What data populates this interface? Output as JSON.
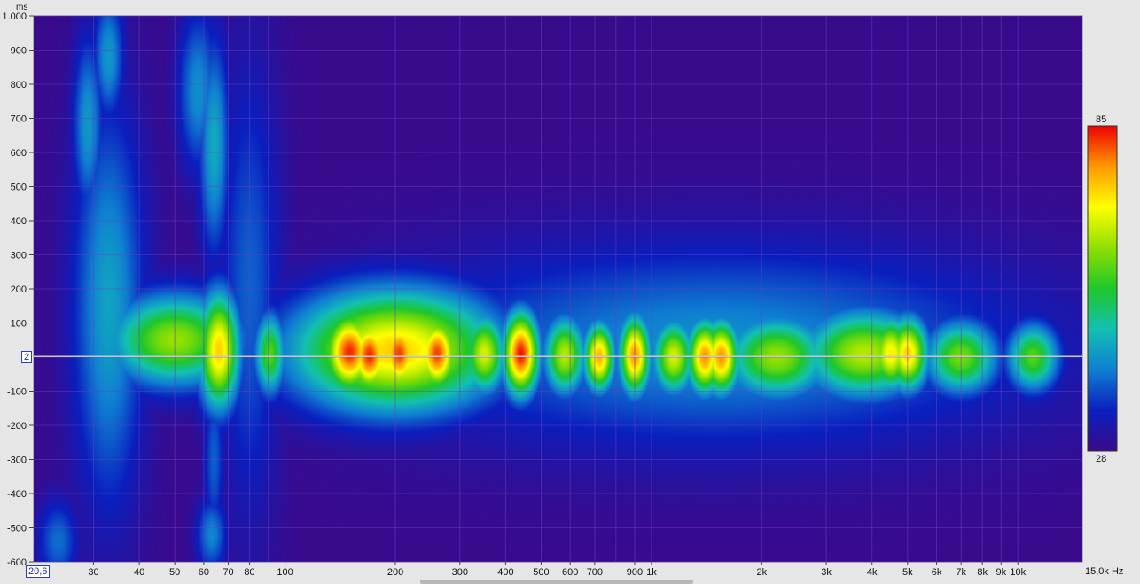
{
  "chart_data": {
    "type": "heatmap",
    "title": "",
    "x_axis": {
      "unit": "Hz",
      "scale": "log",
      "range": [
        20.6,
        15000
      ],
      "ticks": [
        {
          "value": 30,
          "label": "30"
        },
        {
          "value": 40,
          "label": "40"
        },
        {
          "value": 50,
          "label": "50"
        },
        {
          "value": 60,
          "label": "60"
        },
        {
          "value": 70,
          "label": "70"
        },
        {
          "value": 80,
          "label": "80"
        },
        {
          "value": 100,
          "label": "100"
        },
        {
          "value": 200,
          "label": "200"
        },
        {
          "value": 300,
          "label": "300"
        },
        {
          "value": 400,
          "label": "400"
        },
        {
          "value": 500,
          "label": "500"
        },
        {
          "value": 600,
          "label": "600"
        },
        {
          "value": 700,
          "label": "700"
        },
        {
          "value": 900,
          "label": "900"
        },
        {
          "value": 1000,
          "label": "1k"
        },
        {
          "value": 2000,
          "label": "2k"
        },
        {
          "value": 3000,
          "label": "3k"
        },
        {
          "value": 4000,
          "label": "4k"
        },
        {
          "value": 5000,
          "label": "5k"
        },
        {
          "value": 6000,
          "label": "6k"
        },
        {
          "value": 7000,
          "label": "7k"
        },
        {
          "value": 8000,
          "label": "8k"
        },
        {
          "value": 9000,
          "label": "9k"
        },
        {
          "value": 10000,
          "label": "10k"
        }
      ],
      "cursor_label": "20,6",
      "end_label": "15,0k"
    },
    "y_axis": {
      "unit": "ms",
      "range": [
        -600,
        1000
      ],
      "ticks": [
        {
          "value": 1000,
          "label": "1.000"
        },
        {
          "value": 900,
          "label": "900"
        },
        {
          "value": 800,
          "label": "800"
        },
        {
          "value": 700,
          "label": "700"
        },
        {
          "value": 600,
          "label": "600"
        },
        {
          "value": 500,
          "label": "500"
        },
        {
          "value": 400,
          "label": "400"
        },
        {
          "value": 300,
          "label": "300"
        },
        {
          "value": 200,
          "label": "200"
        },
        {
          "value": 100,
          "label": "100"
        },
        {
          "value": -100,
          "label": "-100"
        },
        {
          "value": -200,
          "label": "-200"
        },
        {
          "value": -300,
          "label": "-300"
        },
        {
          "value": -400,
          "label": "-400"
        },
        {
          "value": -500,
          "label": "-500"
        },
        {
          "value": -600,
          "label": "-600"
        }
      ],
      "cursor_value": 2,
      "cursor_label": "2"
    },
    "color_scale": {
      "min": 28,
      "max": 85,
      "min_label": "28",
      "max_label": "85",
      "colors": [
        "#3a0a8c",
        "#0a1fbf",
        "#0f7fd2",
        "#12c0b2",
        "#1ec72a",
        "#8fe000",
        "#ffff00",
        "#ff9900",
        "#ee0000"
      ]
    },
    "grid": true,
    "background_color": "#3f108e",
    "cursor_line_color": "#c8c8c8",
    "blobs": [
      {
        "f": 80,
        "t": 200,
        "f_spread": 0.06,
        "t_spread": 480,
        "level": 40
      },
      {
        "f": 33,
        "t": 150,
        "f_spread": 0.07,
        "t_spread": 420,
        "level": 46
      },
      {
        "f": 29,
        "t": 680,
        "f_spread": 0.03,
        "t_spread": 190,
        "level": 45
      },
      {
        "f": 33,
        "t": 880,
        "f_spread": 0.03,
        "t_spread": 130,
        "level": 45
      },
      {
        "f": 58,
        "t": 780,
        "f_spread": 0.04,
        "t_spread": 170,
        "level": 44
      },
      {
        "f": 64,
        "t": 620,
        "f_spread": 0.03,
        "t_spread": 230,
        "level": 47
      },
      {
        "f": 50,
        "t": 50,
        "f_spread": 0.13,
        "t_spread": 95,
        "level": 64
      },
      {
        "f": 66,
        "t": 20,
        "f_spread": 0.04,
        "t_spread": 120,
        "level": 74
      },
      {
        "f": 91,
        "t": 10,
        "f_spread": 0.03,
        "t_spread": 85,
        "level": 60
      },
      {
        "f": 63,
        "t": -520,
        "f_spread": 0.03,
        "t_spread": 80,
        "level": 43
      },
      {
        "f": 24,
        "t": -540,
        "f_spread": 0.04,
        "t_spread": 90,
        "level": 41
      },
      {
        "f": 64,
        "t": -300,
        "f_spread": 0.02,
        "t_spread": 170,
        "level": 40
      },
      {
        "f": 200,
        "t": 20,
        "f_spread": 0.2,
        "t_spread": 125,
        "level": 74
      },
      {
        "f": 150,
        "t": 15,
        "f_spread": 0.05,
        "t_spread": 85,
        "level": 83
      },
      {
        "f": 170,
        "t": 5,
        "f_spread": 0.04,
        "t_spread": 80,
        "level": 83
      },
      {
        "f": 205,
        "t": 10,
        "f_spread": 0.04,
        "t_spread": 80,
        "level": 82
      },
      {
        "f": 260,
        "t": 10,
        "f_spread": 0.04,
        "t_spread": 80,
        "level": 82
      },
      {
        "f": 350,
        "t": 10,
        "f_spread": 0.04,
        "t_spread": 80,
        "level": 68
      },
      {
        "f": 440,
        "t": 10,
        "f_spread": 0.035,
        "t_spread": 85,
        "level": 84
      },
      {
        "f": 580,
        "t": 5,
        "f_spread": 0.04,
        "t_spread": 80,
        "level": 66
      },
      {
        "f": 720,
        "t": 0,
        "f_spread": 0.03,
        "t_spread": 70,
        "level": 76
      },
      {
        "f": 900,
        "t": 5,
        "f_spread": 0.03,
        "t_spread": 80,
        "level": 78
      },
      {
        "f": 1150,
        "t": 0,
        "f_spread": 0.04,
        "t_spread": 75,
        "level": 68
      },
      {
        "f": 1400,
        "t": 0,
        "f_spread": 0.035,
        "t_spread": 75,
        "level": 78
      },
      {
        "f": 1550,
        "t": 0,
        "f_spread": 0.035,
        "t_spread": 75,
        "level": 78
      },
      {
        "f": 2200,
        "t": 0,
        "f_spread": 0.1,
        "t_spread": 85,
        "level": 64
      },
      {
        "f": 3800,
        "t": 10,
        "f_spread": 0.12,
        "t_spread": 90,
        "level": 66
      },
      {
        "f": 4500,
        "t": 10,
        "f_spread": 0.04,
        "t_spread": 75,
        "level": 72
      },
      {
        "f": 5000,
        "t": 10,
        "f_spread": 0.04,
        "t_spread": 75,
        "level": 74
      },
      {
        "f": 7000,
        "t": 0,
        "f_spread": 0.07,
        "t_spread": 75,
        "level": 62
      },
      {
        "f": 11000,
        "t": 0,
        "f_spread": 0.05,
        "t_spread": 70,
        "level": 60
      },
      {
        "f": 1500,
        "t": 30,
        "f_spread": 0.62,
        "t_spread": 210,
        "level": 44
      }
    ]
  }
}
